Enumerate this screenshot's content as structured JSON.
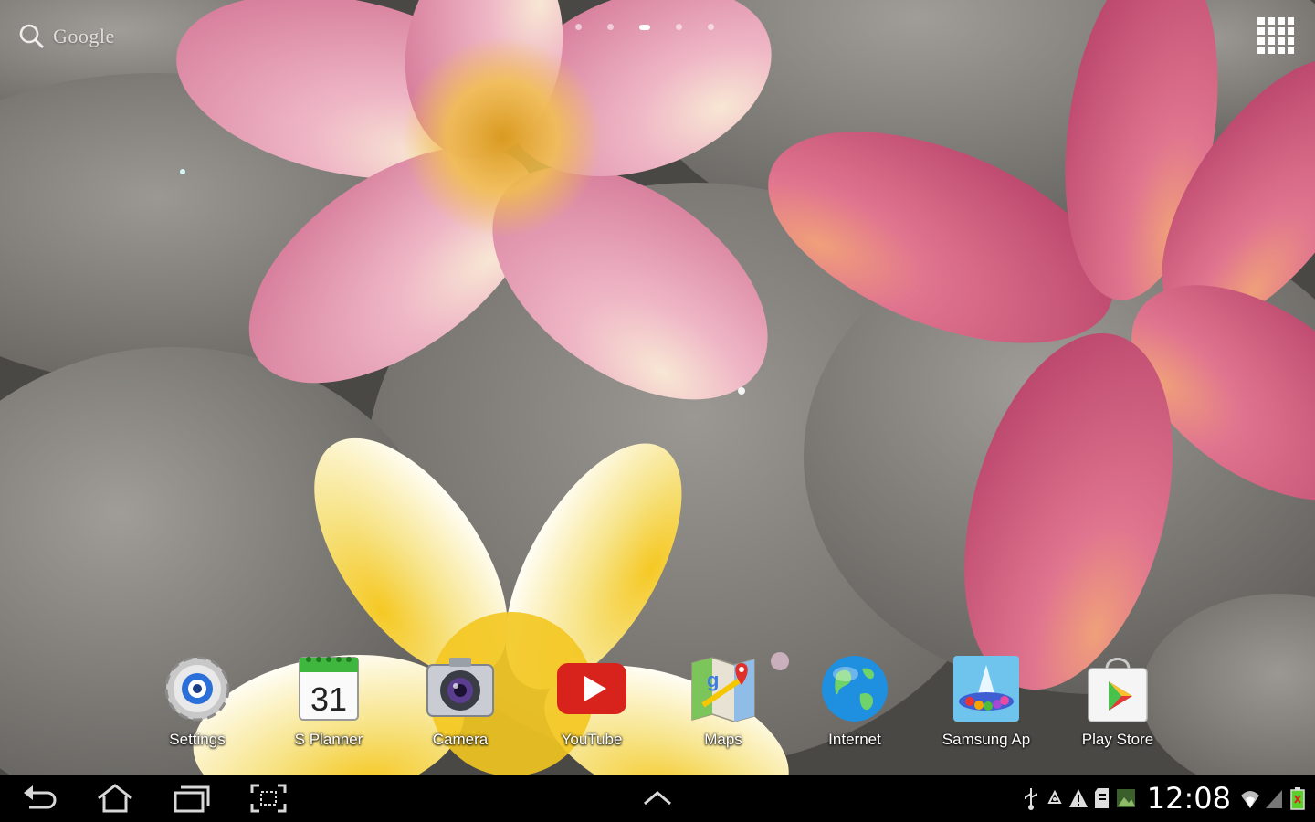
{
  "search": {
    "label": "Google",
    "icon": "search-icon"
  },
  "home_pages": {
    "count": 5,
    "active_index": 2
  },
  "apps_button": {
    "icon": "apps-grid-icon"
  },
  "dock": {
    "apps": [
      {
        "label": "Settings",
        "icon": "settings-gear-icon"
      },
      {
        "label": "S Planner",
        "icon": "calendar-icon",
        "badge": "31"
      },
      {
        "label": "Camera",
        "icon": "camera-icon"
      },
      {
        "label": "YouTube",
        "icon": "youtube-icon"
      },
      {
        "label": "Maps",
        "icon": "maps-icon"
      },
      {
        "label": "Internet",
        "icon": "globe-icon"
      },
      {
        "label": "Samsung Ap",
        "icon": "samsung-apps-icon"
      },
      {
        "label": "Play Store",
        "icon": "play-store-icon"
      }
    ]
  },
  "navbar": {
    "buttons": [
      "back-icon",
      "home-icon",
      "recent-apps-icon",
      "screenshot-icon",
      "chevron-up-icon"
    ]
  },
  "status_bar": {
    "time": "12:08",
    "icons": [
      "usb-icon",
      "recycle-icon",
      "warning-icon",
      "sd-card-icon",
      "image-icon",
      "wifi-icon",
      "signal-icon",
      "battery-charging-icon"
    ]
  },
  "colors": {
    "navbar_bg": "#000000",
    "youtube_red": "#d8231c",
    "battery_green": "#5ad02a"
  }
}
